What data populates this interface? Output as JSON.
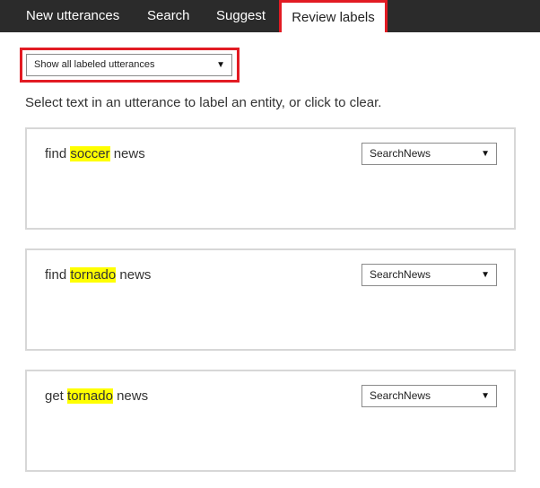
{
  "tabs": [
    {
      "label": "New utterances"
    },
    {
      "label": "Search"
    },
    {
      "label": "Suggest"
    },
    {
      "label": "Review labels"
    }
  ],
  "filter": {
    "selected": "Show all labeled utterances"
  },
  "instructions": "Select text in an utterance to label an entity, or click to clear.",
  "utterances": [
    {
      "before": "find",
      "entity": "soccer",
      "after": "news",
      "intent": "SearchNews"
    },
    {
      "before": "find",
      "entity": "tornado",
      "after": "news",
      "intent": "SearchNews"
    },
    {
      "before": "get",
      "entity": "tornado",
      "after": "news",
      "intent": "SearchNews"
    }
  ],
  "colors": {
    "accent": "#e21b23",
    "highlight": "#ffff00",
    "tabbar": "#2b2b2b"
  },
  "icons": {
    "dropdown": "caret-down-icon"
  }
}
